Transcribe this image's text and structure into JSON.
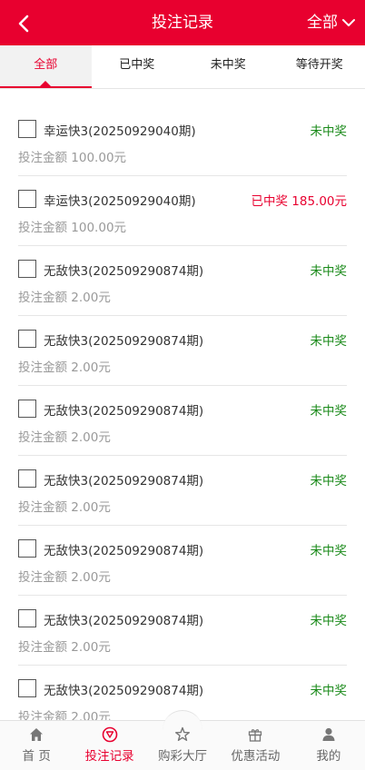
{
  "header": {
    "title": "投注记录",
    "filter_label": "全部"
  },
  "tabs": [
    {
      "label": "全部",
      "active": true
    },
    {
      "label": "已中奖",
      "active": false
    },
    {
      "label": "未中奖",
      "active": false
    },
    {
      "label": "等待开奖",
      "active": false
    }
  ],
  "records": [
    {
      "name": "幸运快3(20250929040期)",
      "status": "未中奖",
      "status_type": "lose",
      "amount": "投注金额 100.00元"
    },
    {
      "name": "幸运快3(20250929040期)",
      "status": "已中奖 185.00元",
      "status_type": "win",
      "amount": "投注金额 100.00元"
    },
    {
      "name": "无敌快3(202509290874期)",
      "status": "未中奖",
      "status_type": "lose",
      "amount": "投注金额 2.00元"
    },
    {
      "name": "无敌快3(202509290874期)",
      "status": "未中奖",
      "status_type": "lose",
      "amount": "投注金额 2.00元"
    },
    {
      "name": "无敌快3(202509290874期)",
      "status": "未中奖",
      "status_type": "lose",
      "amount": "投注金额 2.00元"
    },
    {
      "name": "无敌快3(202509290874期)",
      "status": "未中奖",
      "status_type": "lose",
      "amount": "投注金额 2.00元"
    },
    {
      "name": "无敌快3(202509290874期)",
      "status": "未中奖",
      "status_type": "lose",
      "amount": "投注金额 2.00元"
    },
    {
      "name": "无敌快3(202509290874期)",
      "status": "未中奖",
      "status_type": "lose",
      "amount": "投注金额 2.00元"
    },
    {
      "name": "无敌快3(202509290874期)",
      "status": "未中奖",
      "status_type": "lose",
      "amount": "投注金额 2.00元"
    }
  ],
  "tabbar": [
    {
      "label": "首 页",
      "icon": "home-icon",
      "active": false
    },
    {
      "label": "投注记录",
      "icon": "bet-record-icon",
      "active": true
    },
    {
      "label": "购彩大厅",
      "icon": "lottery-hall-icon",
      "active": false
    },
    {
      "label": "优惠活动",
      "icon": "gift-icon",
      "active": false
    },
    {
      "label": "我的",
      "icon": "user-icon",
      "active": false
    }
  ],
  "colors": {
    "brand": "#e8002f",
    "win": "#e8002f",
    "lose": "#1a8a1a"
  }
}
